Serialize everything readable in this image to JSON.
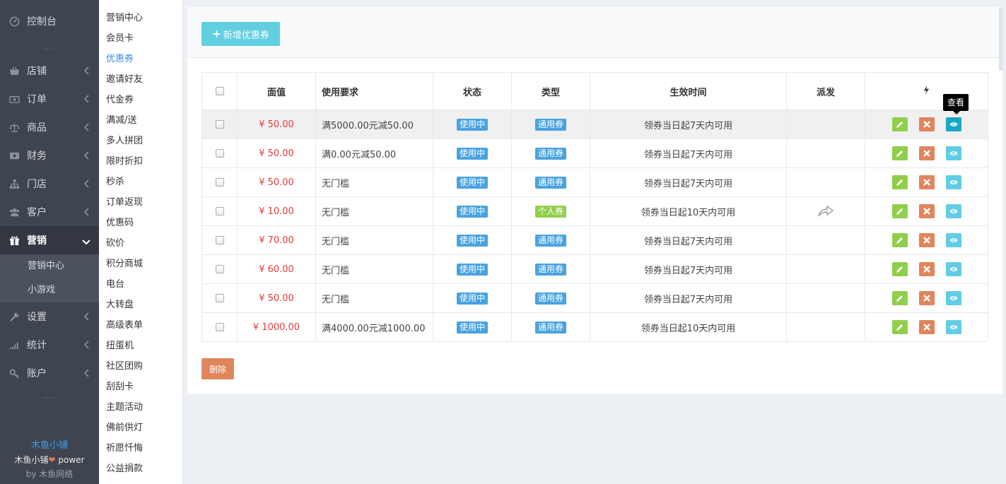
{
  "sidebar": {
    "items": [
      {
        "label": "控制台",
        "icon": "dashboard-icon"
      },
      {
        "label": "店铺",
        "icon": "basket-icon"
      },
      {
        "label": "订单",
        "icon": "money-icon"
      },
      {
        "label": "商品",
        "icon": "scale-icon"
      },
      {
        "label": "财务",
        "icon": "cash-icon"
      },
      {
        "label": "门店",
        "icon": "sitemap-icon"
      },
      {
        "label": "客户",
        "icon": "users-icon"
      },
      {
        "label": "营销",
        "icon": "gift-icon"
      },
      {
        "label": "设置",
        "icon": "wrench-icon"
      },
      {
        "label": "统计",
        "icon": "signal-icon"
      },
      {
        "label": "账户",
        "icon": "key-icon"
      }
    ],
    "sub_items": [
      "营销中心",
      "小游戏"
    ],
    "dots": "····",
    "footer": {
      "brand": "木鱼小铺",
      "power_prefix": "木鱼小铺",
      "power_suffix": " power",
      "by_prefix": "by ",
      "by_name": "木鱼网络"
    }
  },
  "submenu": {
    "items": [
      "营销中心",
      "会员卡",
      "优惠券",
      "邀请好友",
      "代金券",
      "满减/送",
      "多人拼团",
      "限时折扣",
      "秒杀",
      "订单返现",
      "优惠码",
      "砍价",
      "积分商城",
      "电台",
      "大转盘",
      "高级表单",
      "扭蛋机",
      "社区团购",
      "刮刮卡",
      "主题活动",
      "佛前供灯",
      "祈愿忏悔",
      "公益捐款"
    ],
    "active": "优惠券"
  },
  "toolbar": {
    "add_label": "新增优惠券",
    "add_icon": "plus-icon",
    "delete_label": "删除"
  },
  "table": {
    "headers": [
      "面值",
      "使用要求",
      "状态",
      "类型",
      "生效时间",
      "派发"
    ],
    "action_header_icon": "bolt-icon",
    "rows": [
      {
        "value": "¥ 50.00",
        "requirement": "满5000.00元减50.00",
        "status": "使用中",
        "type": "通用券",
        "type_color": "blue",
        "valid": "领券当日起7天内可用",
        "share": false
      },
      {
        "value": "¥ 50.00",
        "requirement": "满0.00元减50.00",
        "status": "使用中",
        "type": "通用券",
        "type_color": "blue",
        "valid": "领券当日起7天内可用",
        "share": false
      },
      {
        "value": "¥ 50.00",
        "requirement": "无门槛",
        "status": "使用中",
        "type": "通用券",
        "type_color": "blue",
        "valid": "领券当日起7天内可用",
        "share": false
      },
      {
        "value": "¥ 10.00",
        "requirement": "无门槛",
        "status": "使用中",
        "type": "个人券",
        "type_color": "green",
        "valid": "领券当日起10天内可用",
        "share": true
      },
      {
        "value": "¥ 70.00",
        "requirement": "无门槛",
        "status": "使用中",
        "type": "通用券",
        "type_color": "blue",
        "valid": "领券当日起7天内可用",
        "share": false
      },
      {
        "value": "¥ 60.00",
        "requirement": "无门槛",
        "status": "使用中",
        "type": "通用券",
        "type_color": "blue",
        "valid": "领券当日起7天内可用",
        "share": false
      },
      {
        "value": "¥ 50.00",
        "requirement": "无门槛",
        "status": "使用中",
        "type": "通用券",
        "type_color": "blue",
        "valid": "领券当日起7天内可用",
        "share": false
      },
      {
        "value": "¥ 1000.00",
        "requirement": "满4000.00元减1000.00",
        "status": "使用中",
        "type": "通用券",
        "type_color": "blue",
        "valid": "领券当日起10天内可用",
        "share": false
      }
    ]
  },
  "tooltip": {
    "text": "查看"
  },
  "colors": {
    "sidebar_bg": "#3f4550",
    "accent": "#3c8ddd",
    "price": "#e43a3a",
    "edit": "#8fcf4c",
    "delete": "#e0855c",
    "view": "#61cde4"
  }
}
